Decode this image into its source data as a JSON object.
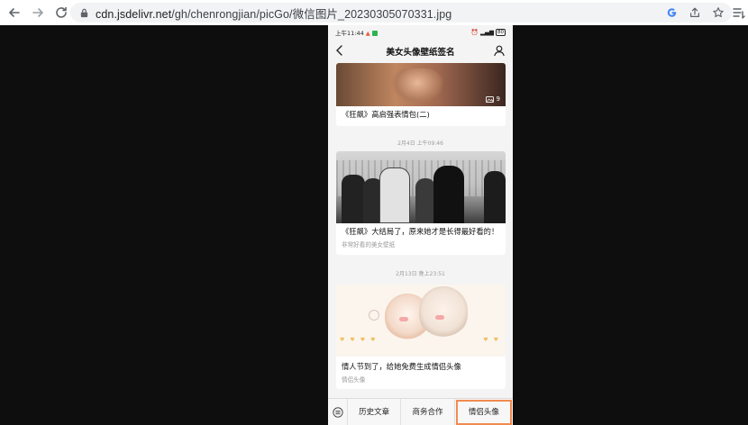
{
  "browser": {
    "url_host": "cdn.jsdelivr.net",
    "url_path": "/gh/chenrongjian/picGo/微信图片_20230305070331.jpg"
  },
  "phone": {
    "status_time": "上午11:44",
    "status_battery": "80",
    "page_title": "美女头像壁纸签名"
  },
  "feed": {
    "cards": [
      {
        "title": "《狂飙》高启强表情包(二)",
        "image_count": "9"
      },
      {
        "timestamp": "2月4日 上午09:46",
        "title": "《狂飙》大结局了，原来她才是长得最好看的！",
        "subtitle": "非常好看的美女壁纸"
      },
      {
        "timestamp": "2月13日 晚上23:51",
        "title": "情人节到了，给她免费生成情侣头像",
        "subtitle": "情侣头像"
      }
    ]
  },
  "bottom_menu": {
    "items": [
      "历史文章",
      "商务合作",
      "情侣头像"
    ],
    "highlight_color": "#f28a4f"
  },
  "colors": {
    "background": "#0e0e0e",
    "wechat_green": "#2db24e"
  }
}
